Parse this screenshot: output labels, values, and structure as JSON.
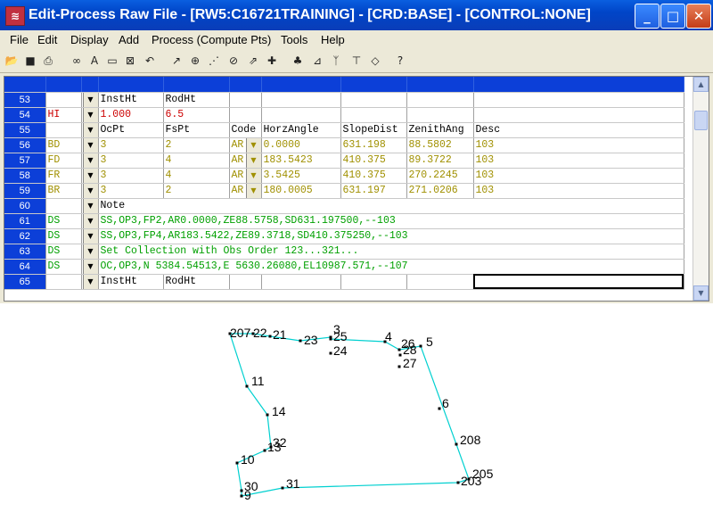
{
  "window": {
    "title": "Edit-Process Raw File - [RW5:C16721TRAINING] - [CRD:BASE] - [CONTROL:NONE]",
    "app_icon": "survey-app-icon",
    "controls": [
      "minimize",
      "maximize",
      "close"
    ]
  },
  "menu": [
    "File",
    "Edit",
    "Display",
    "Add",
    "Process (Compute Pts)",
    "Tools",
    "Help"
  ],
  "toolbar_icons": [
    "open-folder-icon",
    "save-icon",
    "print-icon",
    "binoculars-icon",
    "font-icon",
    "new-record-icon",
    "delete-record-icon",
    "undo-icon",
    "sketch-icon",
    "target-icon",
    "traverse-icon",
    "inverse-icon",
    "stakeout-icon",
    "plus-point-icon",
    "tree-icon",
    "graph-icon",
    "person-icon",
    "level-icon",
    "notes-icon",
    "help-icon"
  ],
  "grid": {
    "rows": [
      {
        "num": "53",
        "type": "",
        "cells": [
          "InstHt",
          "RodHt",
          "",
          "",
          "",
          "",
          ""
        ],
        "color": "black"
      },
      {
        "num": "54",
        "type": "HI",
        "cells": [
          "1.000",
          "6.5",
          "",
          "",
          "",
          "",
          ""
        ],
        "color": "red"
      },
      {
        "num": "55",
        "type": "",
        "cells": [
          "OcPt",
          "FsPt",
          "Code",
          "HorzAngle",
          "SlopeDist",
          "ZenithAng",
          "Desc"
        ],
        "color": "black"
      },
      {
        "num": "56",
        "type": "BD",
        "cells": [
          "3",
          "2",
          "AR",
          "0.0000",
          "631.198",
          "88.5802",
          "103"
        ],
        "color": "olive"
      },
      {
        "num": "57",
        "type": "FD",
        "cells": [
          "3",
          "4",
          "AR",
          "183.5423",
          "410.375",
          "89.3722",
          "103"
        ],
        "color": "olive"
      },
      {
        "num": "58",
        "type": "FR",
        "cells": [
          "3",
          "4",
          "AR",
          "3.5425",
          "410.375",
          "270.2245",
          "103"
        ],
        "color": "olive"
      },
      {
        "num": "59",
        "type": "BR",
        "cells": [
          "3",
          "2",
          "AR",
          "180.0005",
          "631.197",
          "271.0206",
          "103"
        ],
        "color": "olive"
      },
      {
        "num": "60",
        "type": "",
        "cells": [
          "Note"
        ],
        "color": "black"
      },
      {
        "num": "61",
        "type": "DS",
        "cells": [
          "SS,OP3,FP2,AR0.0000,ZE88.5758,SD631.197500,--103"
        ],
        "color": "green"
      },
      {
        "num": "62",
        "type": "DS",
        "cells": [
          "SS,OP3,FP4,AR183.5422,ZE89.3718,SD410.375250,--103"
        ],
        "color": "green"
      },
      {
        "num": "63",
        "type": "DS",
        "cells": [
          "Set Collection with Obs Order 123...321..."
        ],
        "color": "green"
      },
      {
        "num": "64",
        "type": "DS",
        "cells": [
          "OC,OP3,N 5384.54513,E 5630.26080,EL10987.571,--107"
        ],
        "color": "green"
      },
      {
        "num": "65",
        "type": "",
        "cells": [
          "InstHt",
          "RodHt",
          "",
          "",
          "",
          "",
          ""
        ],
        "color": "black"
      }
    ]
  },
  "plot": {
    "points": [
      {
        "id": "207",
        "label": "207"
      },
      {
        "id": "22",
        "label": "22"
      },
      {
        "id": "21",
        "label": "21"
      },
      {
        "id": "23",
        "label": "23"
      },
      {
        "id": "3",
        "label": "3"
      },
      {
        "id": "25",
        "label": "25"
      },
      {
        "id": "24",
        "label": "24"
      },
      {
        "id": "4",
        "label": "4"
      },
      {
        "id": "26",
        "label": "26"
      },
      {
        "id": "5",
        "label": "5"
      },
      {
        "id": "28",
        "label": "28"
      },
      {
        "id": "27",
        "label": "27"
      },
      {
        "id": "11",
        "label": "11"
      },
      {
        "id": "6",
        "label": "6"
      },
      {
        "id": "14",
        "label": "14"
      },
      {
        "id": "208",
        "label": "208"
      },
      {
        "id": "32",
        "label": "32"
      },
      {
        "id": "13",
        "label": "13"
      },
      {
        "id": "10",
        "label": "10"
      },
      {
        "id": "205",
        "label": "205"
      },
      {
        "id": "203",
        "label": "203"
      },
      {
        "id": "31",
        "label": "31"
      },
      {
        "id": "30",
        "label": "30"
      },
      {
        "id": "9",
        "label": "9"
      }
    ],
    "line_color": "#00d0d0"
  },
  "colors": {
    "titlebar": "#0045c8",
    "rownum_bg": "#0c3fd8",
    "red": "#cc0000",
    "olive": "#a09000",
    "green": "#00a000"
  }
}
